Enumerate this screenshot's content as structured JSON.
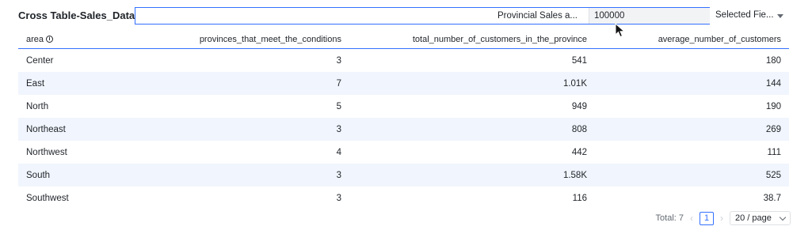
{
  "header": {
    "title": "Cross Table-Sales_Data",
    "filter_label": "Provincial Sales a...",
    "filter_value": "100000",
    "selected_fields": "Selected Fie..."
  },
  "table": {
    "columns": [
      "area",
      "provinces_that_meet_the_conditions",
      "total_number_of_customers_in_the_province",
      "average_number_of_customers"
    ],
    "rows": [
      [
        "Center",
        "3",
        "541",
        "180"
      ],
      [
        "East",
        "7",
        "1.01K",
        "144"
      ],
      [
        "North",
        "5",
        "949",
        "190"
      ],
      [
        "Northeast",
        "3",
        "808",
        "269"
      ],
      [
        "Northwest",
        "4",
        "442",
        "111"
      ],
      [
        "South",
        "3",
        "1.58K",
        "525"
      ],
      [
        "Southwest",
        "3",
        "116",
        "38.7"
      ]
    ]
  },
  "pagination": {
    "total": "Total: 7",
    "current_page": "1",
    "page_size": "20 / page",
    "prev_icon": "chevron-left-icon",
    "next_icon": "chevron-right-icon"
  },
  "colors": {
    "accent": "#3370ff",
    "row_stripe": "#f1f5fd",
    "filter_value_bg": "#f2f3f5"
  }
}
